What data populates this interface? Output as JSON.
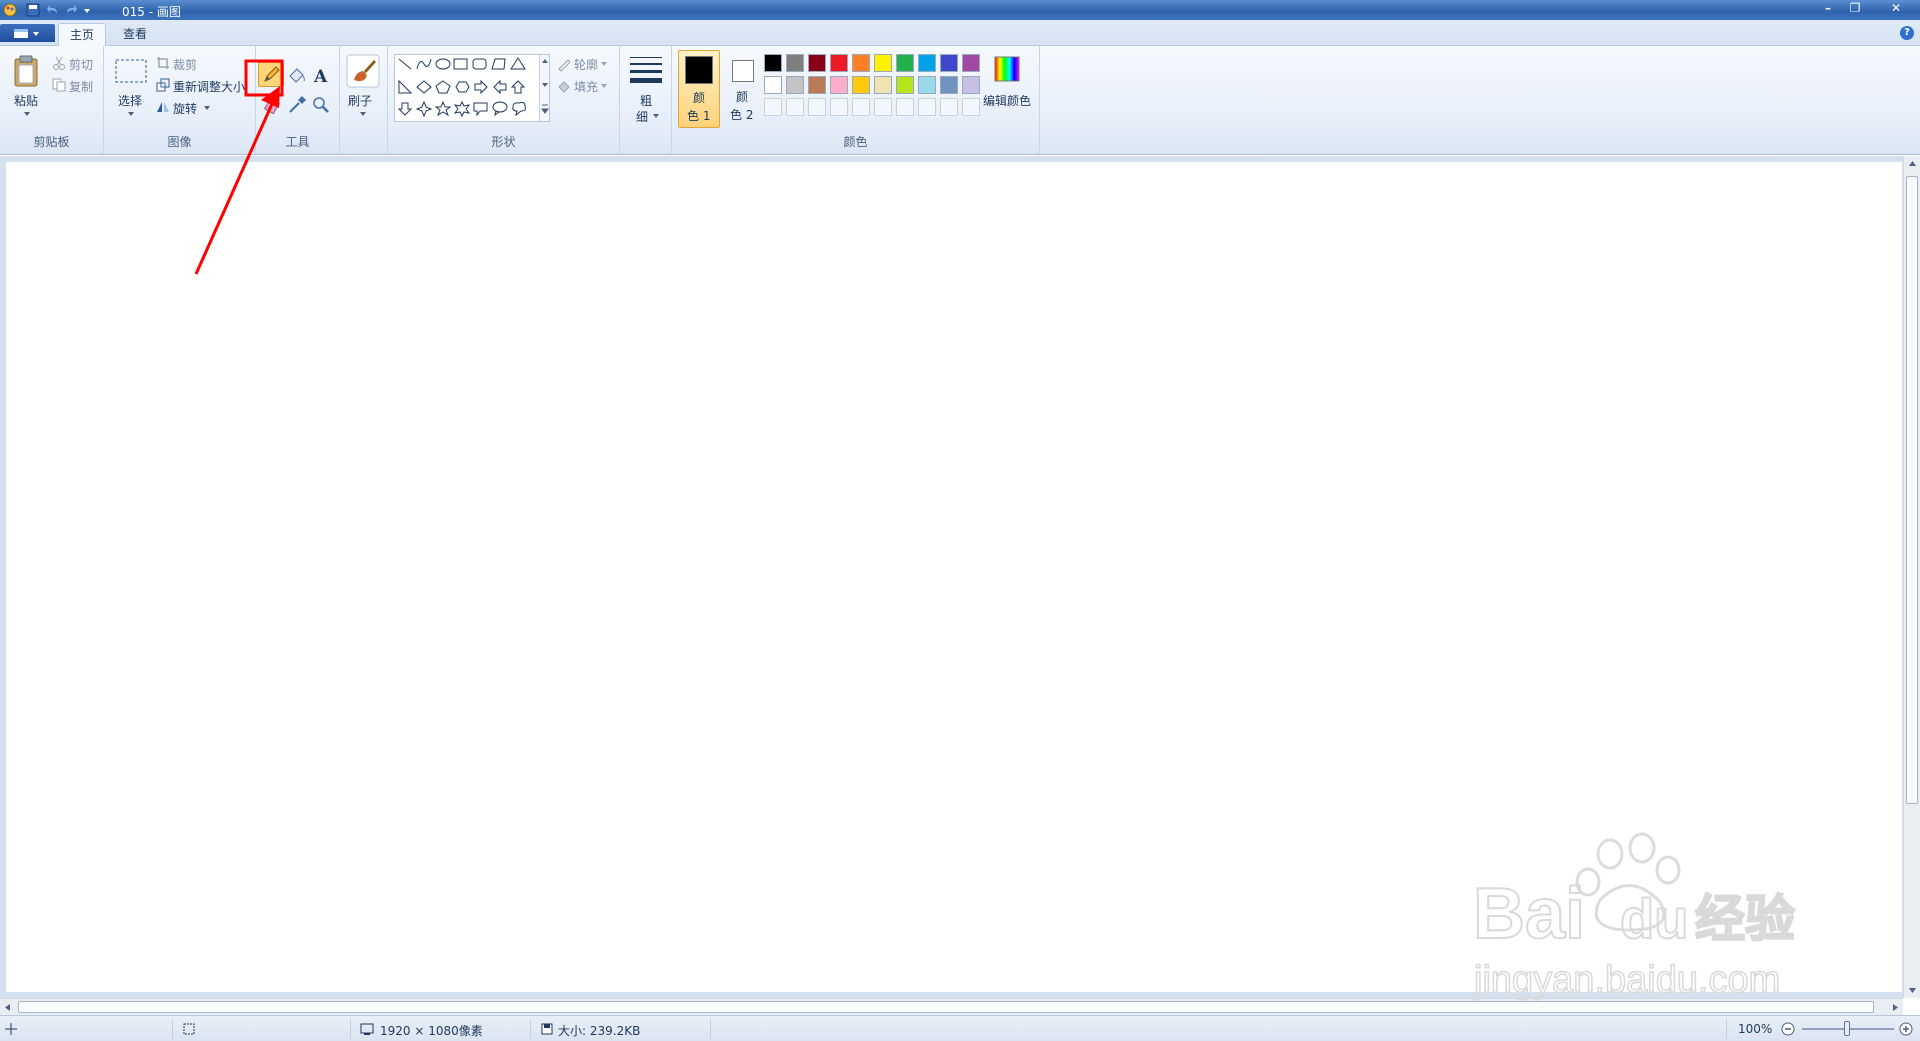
{
  "window": {
    "title": "015 - 画图",
    "buttons": {
      "minimize": "–",
      "maximize": "❐",
      "close": "✕"
    }
  },
  "tabs": [
    {
      "label": "主页",
      "active": true
    },
    {
      "label": "查看",
      "active": false
    }
  ],
  "ribbon": {
    "clipboard": {
      "label": "剪贴板",
      "paste": "粘贴",
      "cut": "剪切",
      "copy": "复制"
    },
    "image": {
      "label": "图像",
      "select": "选择",
      "crop": "裁剪",
      "resize": "重新调整大小",
      "rotate": "旋转"
    },
    "tools": {
      "label": "工具",
      "highlighted": "pencil-tool"
    },
    "brushes": {
      "label": "刷子"
    },
    "shapes": {
      "label": "形状",
      "outline": "轮廓",
      "fill": "填充"
    },
    "size": {
      "label_top": "粗",
      "label_bottom": "细"
    },
    "colors": {
      "label": "颜色",
      "color1": {
        "label_top": "颜",
        "label_bottom": "色 1",
        "value": "#000000"
      },
      "color2": {
        "label_top": "颜",
        "label_bottom": "色 2",
        "value": "#ffffff"
      },
      "edit": "编辑颜色",
      "palette_row1": [
        "#000000",
        "#7f7f7f",
        "#880015",
        "#ed1c24",
        "#ff7f27",
        "#fff200",
        "#22b14c",
        "#00a2e8",
        "#3f48cc",
        "#a349a4"
      ],
      "palette_row2": [
        "#ffffff",
        "#c3c3c3",
        "#b97a57",
        "#ffaec9",
        "#ffc90e",
        "#efe4b0",
        "#b5e61d",
        "#99d9ea",
        "#7092be",
        "#c8bfe7"
      ]
    }
  },
  "statusbar": {
    "dimensions": "1920 × 1080像素",
    "size": "大小: 239.2KB",
    "zoom": "100%"
  },
  "annotation": {
    "color": "#ff0000"
  },
  "watermark": {
    "brand": "Bai",
    "brand2": "du",
    "cn": "经验",
    "url": "jingyan.baidu.com"
  }
}
